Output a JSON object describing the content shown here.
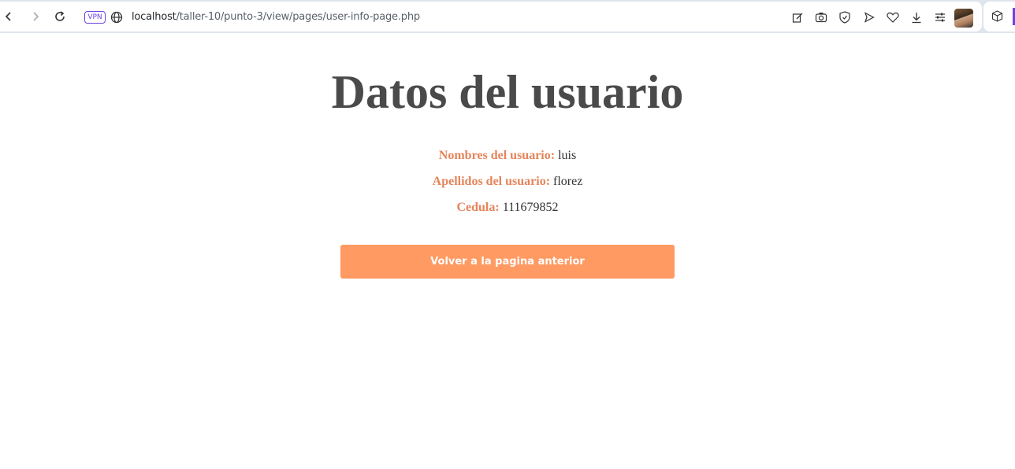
{
  "browser": {
    "vpn_label": "VPN",
    "url_host": "localhost",
    "url_path": "/taller-10/punto-3/view/pages/user-info-page.php",
    "accent_color": "#6a42e8"
  },
  "page": {
    "title": "Datos del usuario",
    "fields": [
      {
        "label": "Nombres del usuario:",
        "value": "luis"
      },
      {
        "label": "Apellidos del usuario:",
        "value": "florez"
      },
      {
        "label": "Cedula:",
        "value": "111679852"
      }
    ],
    "back_button_label": "Volver a la pagina anterior",
    "label_color": "#e5845a",
    "button_color": "#ff9a62"
  }
}
